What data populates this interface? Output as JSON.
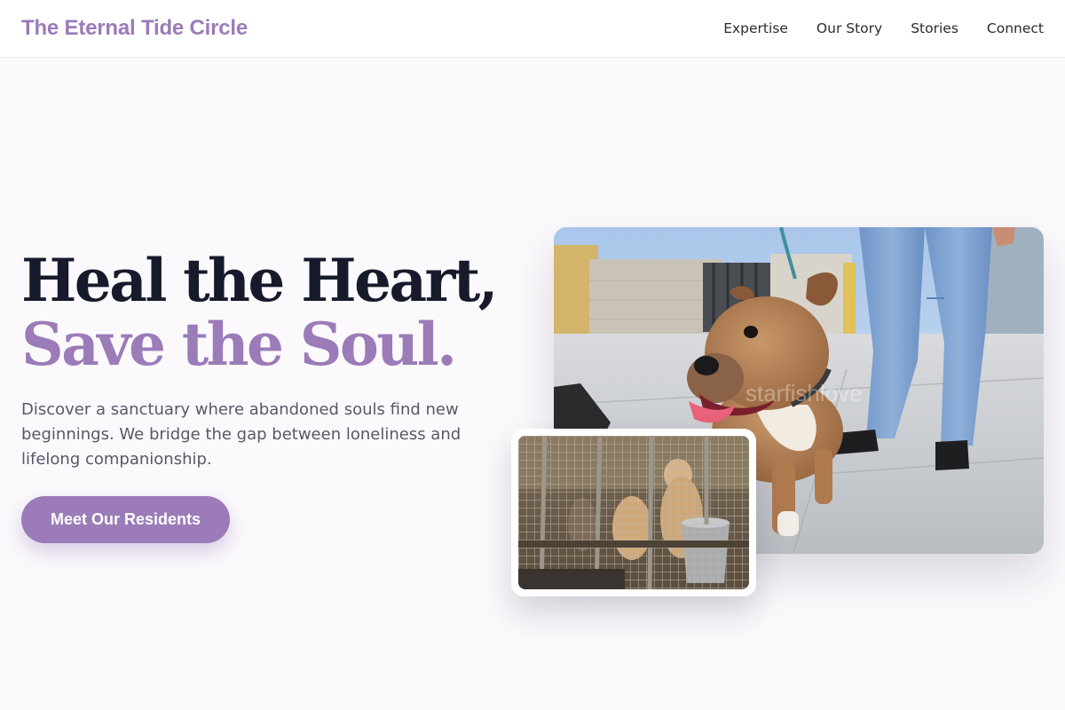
{
  "header": {
    "brand": "The Eternal Tide Circle",
    "nav": [
      "Expertise",
      "Our Story",
      "Stories",
      "Connect"
    ]
  },
  "hero": {
    "title_line1": "Heal the Heart,",
    "title_line2": "Save the Soul.",
    "description": "Discover a sanctuary where abandoned souls find new beginnings. We bridge the gap between loneliness and lifelong companionship.",
    "cta_label": "Meet Our Residents"
  },
  "colors": {
    "accent": "#9b7bb8",
    "heading": "#161a2b",
    "body_text": "#555a68",
    "background": "#fbf9fc"
  },
  "images": {
    "main_photo": "dog-on-leash-photo",
    "secondary_photo": "dogs-in-kennel-photo"
  }
}
